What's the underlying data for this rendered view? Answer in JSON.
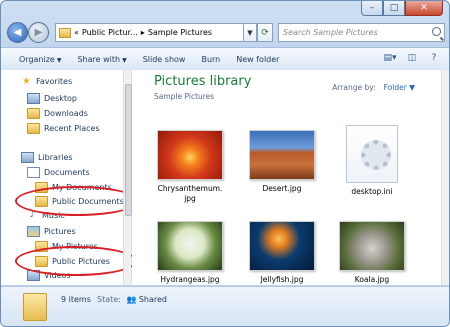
{
  "window": {
    "caption": {
      "minimize": "–",
      "maximize": "□",
      "close": "✕"
    }
  },
  "address": {
    "prefix": "«",
    "crumbs": [
      "Public Pictur...",
      "Sample Pictures"
    ],
    "sep": "▸",
    "search_placeholder": "Search Sample Pictures"
  },
  "toolbar": {
    "organize": "Organize",
    "share_with": "Share with",
    "slide_show": "Slide show",
    "burn": "Burn",
    "new_folder": "New folder",
    "dropdown_arrow": "▼"
  },
  "sidebar": {
    "favorites": "Favorites",
    "desktop": "Desktop",
    "downloads": "Downloads",
    "recent_places": "Recent Places",
    "libraries": "Libraries",
    "documents": "Documents",
    "my_documents": "My Documents",
    "public_documents": "Public Documents",
    "music": "Music",
    "pictures": "Pictures",
    "my_pictures": "My Pictures",
    "public_pictures": "Public Pictures",
    "videos": "Videos"
  },
  "main": {
    "title": "Pictures library",
    "subtitle": "Sample Pictures",
    "arrange_label": "Arrange by:",
    "arrange_value": "Folder ▼",
    "files": [
      {
        "name_line1": "Chrysanthemum.",
        "name_line2": "jpg"
      },
      {
        "name_line1": "Desert.jpg",
        "name_line2": ""
      },
      {
        "name_line1": "desktop.ini",
        "name_line2": ""
      },
      {
        "name_line1": "Hydrangeas.jpg",
        "name_line2": ""
      },
      {
        "name_line1": "Jellyfish.jpg",
        "name_line2": ""
      },
      {
        "name_line1": "Koala.jpg",
        "name_line2": ""
      }
    ]
  },
  "details": {
    "count": "9 items",
    "state_label": "State:",
    "state_value": "Shared"
  },
  "colors": {
    "highlight": "#d81f26",
    "library_title": "#1b7a3a"
  }
}
